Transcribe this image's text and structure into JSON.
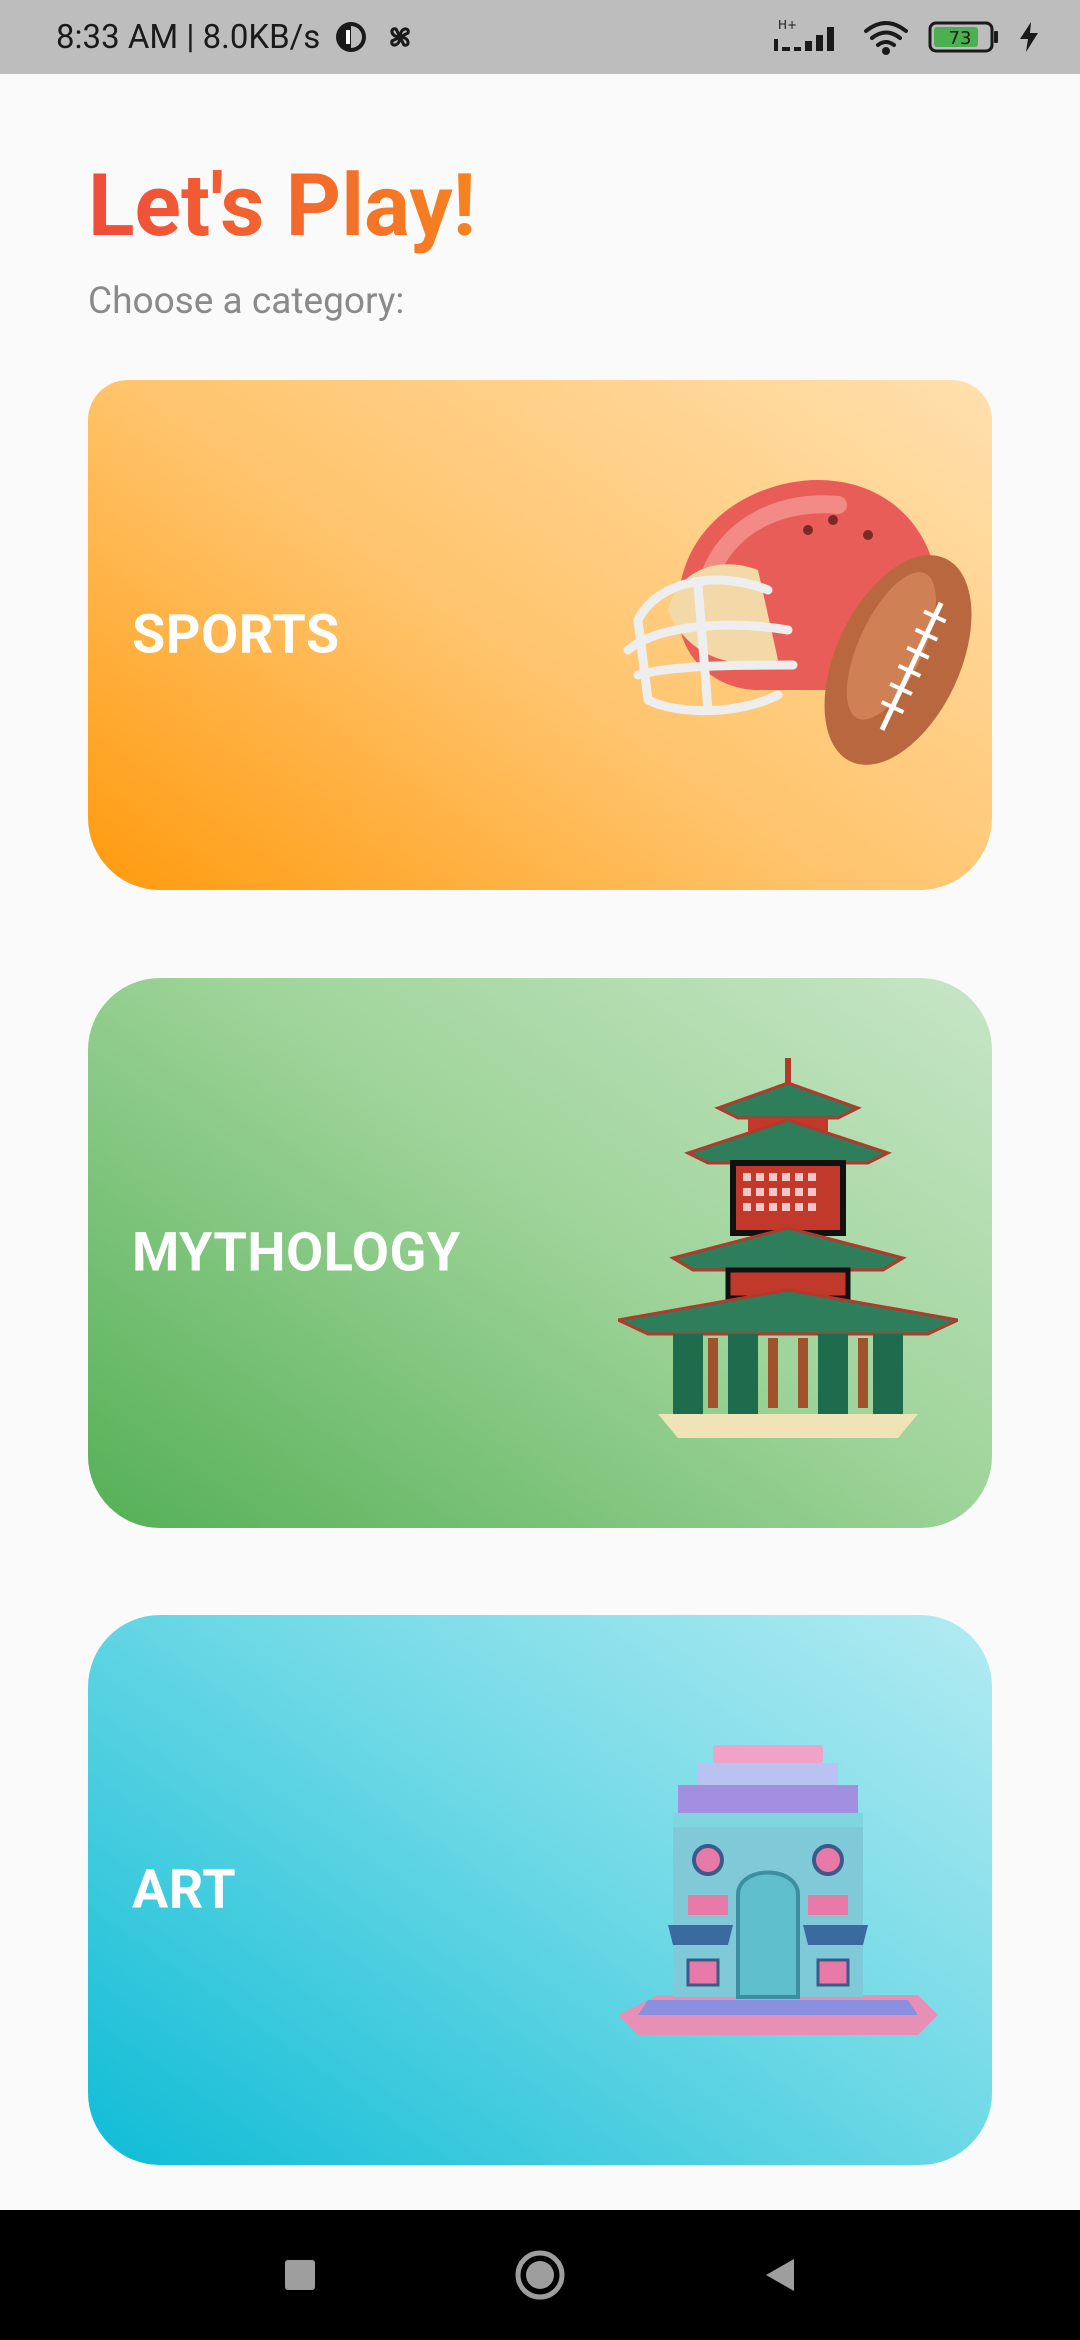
{
  "status_bar": {
    "time_speed": "8:33 AM | 8.0KB/s",
    "battery": "73",
    "network": "H+"
  },
  "header": {
    "title": "Let's Play!",
    "subtitle": "Choose a category:"
  },
  "categories": [
    {
      "label": "SPORTS",
      "icon": "football-helmet-icon",
      "color": "#ff9a0d"
    },
    {
      "label": "MYTHOLOGY",
      "icon": "pagoda-temple-icon",
      "color": "#55b056"
    },
    {
      "label": "ART",
      "icon": "monument-gate-icon",
      "color": "#0fbcd6"
    }
  ],
  "nav": {
    "recents": "square-icon",
    "home": "circle-icon",
    "back": "triangle-back-icon"
  }
}
